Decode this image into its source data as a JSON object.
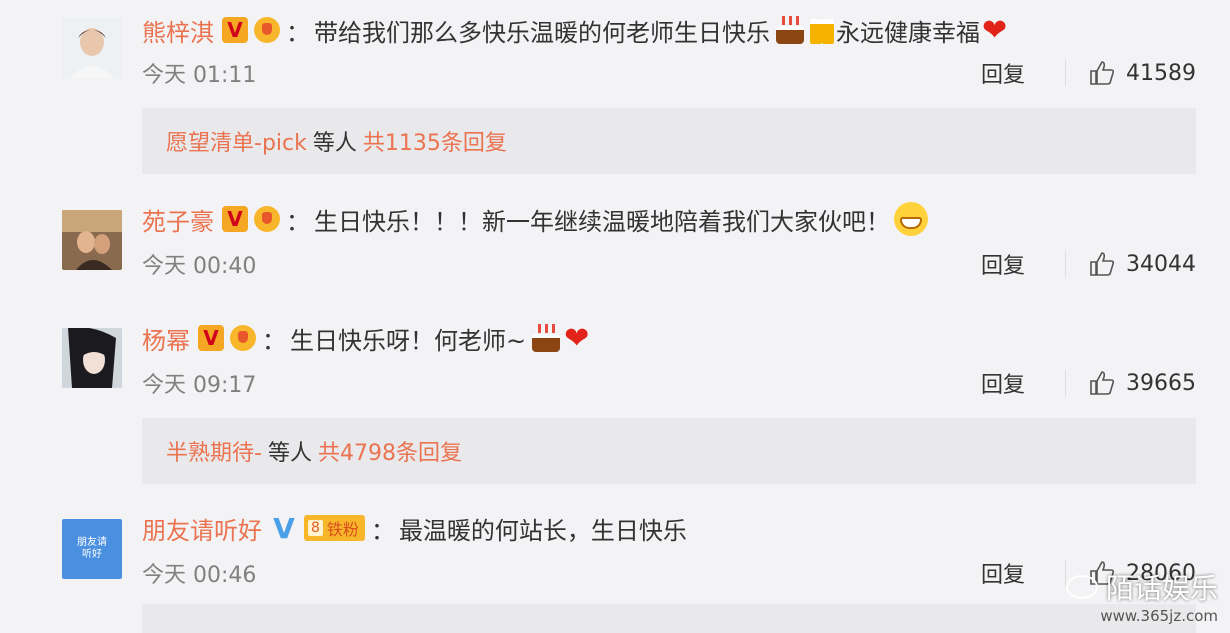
{
  "comments": [
    {
      "username": "熊梓淇",
      "vip": "V",
      "text": "带给我们那么多快乐温暖的何老师生日快乐",
      "text2": "永远健康幸福",
      "time": "今天 01:11",
      "reply_label": "回复",
      "likes": "41589",
      "replies": {
        "name": "愿望清单-pick",
        "etc": "等人",
        "count": "共1135条回复"
      }
    },
    {
      "username": "苑子豪",
      "vip": "V",
      "text": "生日快乐！！！新一年继续温暖地陪着我们大家伙吧！",
      "time": "今天 00:40",
      "reply_label": "回复",
      "likes": "34044"
    },
    {
      "username": "杨幂",
      "vip": "V",
      "text": "生日快乐呀！何老师~",
      "time": "今天 09:17",
      "reply_label": "回复",
      "likes": "39665",
      "replies": {
        "name": "半熟期待-",
        "etc": "等人",
        "count": "共4798条回复"
      }
    },
    {
      "username": "朋友请听好",
      "vip": "V",
      "badge_num": "8",
      "badge_text": "铁粉",
      "text": "最温暖的何站长，生日快乐",
      "time": "今天 00:46",
      "reply_label": "回复",
      "likes": "28060"
    }
  ],
  "avatar4_text": "朋友请听好",
  "watermark": {
    "main": "陌话娱乐",
    "url": "www.365jz.com"
  },
  "colors": {
    "username": "#eb7350",
    "background": "#f3f3f5",
    "reply_box": "#e9e9eb"
  }
}
